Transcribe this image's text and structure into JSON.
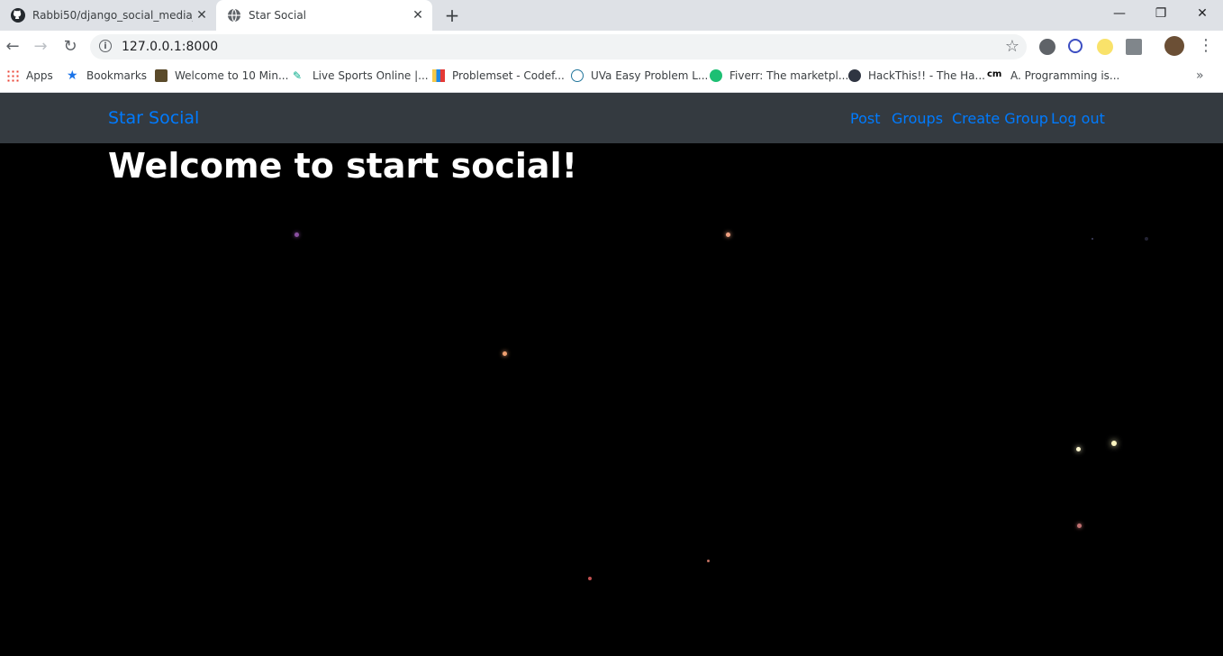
{
  "browser": {
    "tabs": [
      {
        "title": "Rabbi50/django_social_media_cl",
        "active": false
      },
      {
        "title": "Star Social",
        "active": true
      }
    ],
    "url": "127.0.0.1:8000",
    "bookmarks": [
      {
        "label": "Apps"
      },
      {
        "label": "Bookmarks"
      },
      {
        "label": "Welcome to 10 Min..."
      },
      {
        "label": "Live Sports Online |..."
      },
      {
        "label": "Problemset - Codef..."
      },
      {
        "label": "UVa Easy Problem L..."
      },
      {
        "label": "Fiverr: The marketpl..."
      },
      {
        "label": "HackThis!! - The Ha..."
      },
      {
        "label": "A. Programming is..."
      }
    ]
  },
  "site": {
    "brand": "Star Social",
    "nav": [
      {
        "label": "Post"
      },
      {
        "label": "Groups"
      },
      {
        "label": "Create Group"
      },
      {
        "label": "Log out"
      }
    ],
    "heading": "Welcome to start social!"
  },
  "colors": {
    "link": "#007bff",
    "navbar_bg": "#343a40",
    "page_bg": "#000000"
  }
}
